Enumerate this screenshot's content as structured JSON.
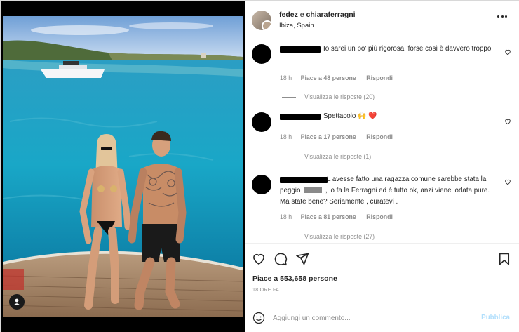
{
  "post": {
    "author1": "fedez",
    "conjunction": "e",
    "author2": "chiaraferragni",
    "location": "Ibiza, Spain"
  },
  "comments": [
    {
      "text": "Io sarei un po' più rigorosa, forse così è davvero troppo",
      "time": "18 h",
      "likes": "Piace a 48 persone",
      "reply": "Rispondi",
      "view_replies": "Visualizza le risposte (20)"
    },
    {
      "text": "Spettacolo 🙌 ❤️",
      "time": "18 h",
      "likes": "Piace a 17 persone",
      "reply": "Rispondi",
      "view_replies": "Visualizza le risposte (1)"
    },
    {
      "text_before": "L avesse fatto una ragazza comune sarebbe stata la peggio",
      "text_after": ", lo fa la Ferragni ed è tutto ok, anzi viene lodata pure. Ma state bene? Seriamente , curatevi .",
      "time": "18 h",
      "likes": "Piace a 81 persone",
      "reply": "Rispondi",
      "view_replies": "Visualizza le risposte (27)"
    }
  ],
  "footer": {
    "likes": "Piace a 553,658 persone",
    "time_ago": "18 ORE FA",
    "comment_placeholder": "Aggiungi un commento...",
    "publish": "Pubblica"
  },
  "icons": {
    "like": "heart-icon",
    "comment": "comment-bubble-icon",
    "share": "paper-plane-icon",
    "save": "bookmark-icon",
    "more": "more-options-icon",
    "emoji": "emoji-icon",
    "tagged": "user-tag-icon"
  },
  "colors": {
    "publish_disabled": "#b2dffc",
    "secondary_text": "#8e8e8e",
    "primary_text": "#262626"
  }
}
